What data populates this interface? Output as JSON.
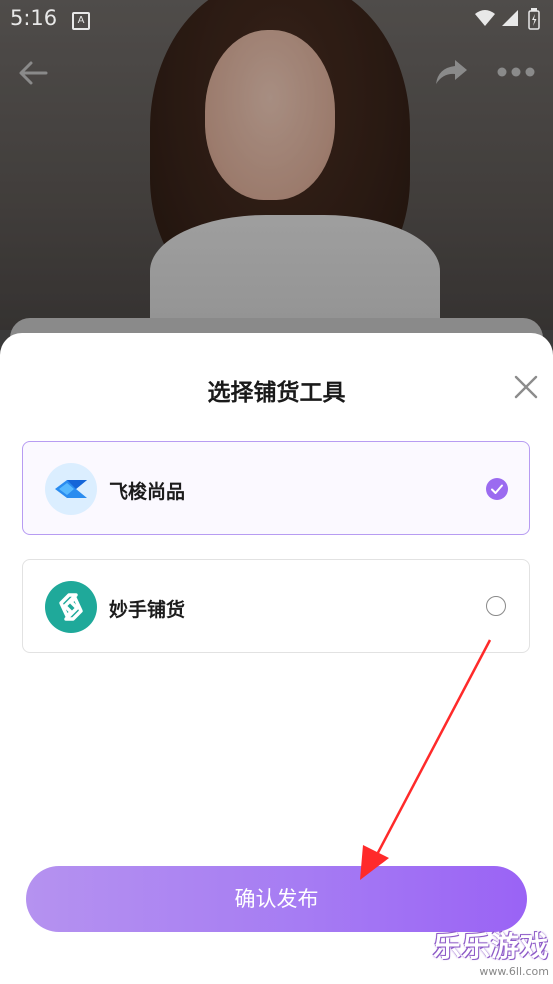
{
  "status_bar": {
    "time": "5:16",
    "notification_icon": "A"
  },
  "top_bar": {
    "back": "back-arrow-icon",
    "share": "share-icon",
    "more": "more-dots-icon"
  },
  "sheet": {
    "title": "选择铺货工具",
    "options": [
      {
        "label": "飞梭尚品",
        "selected": true,
        "icon": "feisuo-logo"
      },
      {
        "label": "妙手铺货",
        "selected": false,
        "icon": "miaoshou-logo"
      }
    ],
    "confirm_label": "确认发布"
  },
  "watermark": {
    "text": "乐乐游戏",
    "url": "www.6ll.com"
  },
  "colors": {
    "accent": "#9b6bf0",
    "button_start": "#b592f0",
    "button_end": "#9a63f5",
    "arrow": "#ff2a2a"
  }
}
